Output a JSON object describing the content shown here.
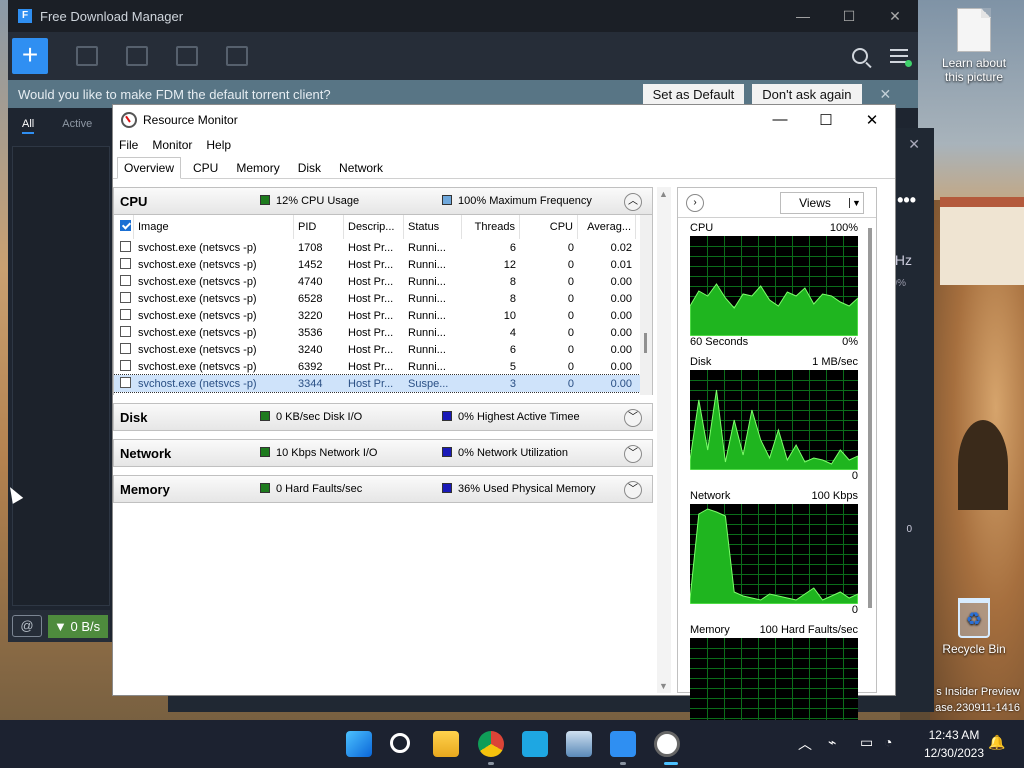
{
  "desktop": {
    "icons": [
      {
        "label": "Learn about this picture"
      },
      {
        "label": "Recycle Bin"
      }
    ],
    "watermark": {
      "line1": "s Insider Preview",
      "line2": "ase.230911-1416"
    }
  },
  "fdm": {
    "title": "Free Download Manager",
    "banner": {
      "text": "Would you like to make FDM the default torrent client?",
      "set_default": "Set as Default",
      "dont_ask": "Don't ask again"
    },
    "tabs": [
      "All",
      "Active"
    ],
    "speed": "0 B/s"
  },
  "bgwin": {
    "hz": "Hz",
    "pct": "0%",
    "zero": "0"
  },
  "rm": {
    "title": "Resource Monitor",
    "menu": [
      "File",
      "Monitor",
      "Help"
    ],
    "tabs": [
      "Overview",
      "CPU",
      "Memory",
      "Disk",
      "Network"
    ],
    "sections": {
      "cpu": {
        "name": "CPU",
        "stat1": "12% CPU Usage",
        "stat2": "100% Maximum Frequency",
        "c1": "#1e7b1e",
        "c2": "#6fa8dc"
      },
      "disk": {
        "name": "Disk",
        "stat1": "0 KB/sec Disk I/O",
        "stat2": "0% Highest Active Timee",
        "c1": "#1e7b1e",
        "c2": "#1a1ab8"
      },
      "network": {
        "name": "Network",
        "stat1": "10 Kbps Network I/O",
        "stat2": "0% Network Utilization",
        "c1": "#1e7b1e",
        "c2": "#1a1ab8"
      },
      "memory": {
        "name": "Memory",
        "stat1": "0 Hard Faults/sec",
        "stat2": "36% Used Physical Memory",
        "c1": "#1e7b1e",
        "c2": "#1a1ab8"
      }
    },
    "table": {
      "headers": {
        "image": "Image",
        "pid": "PID",
        "desc": "Descrip...",
        "status": "Status",
        "threads": "Threads",
        "cpu": "CPU",
        "avg": "Averag..."
      },
      "rows": [
        {
          "image": "svchost.exe (netsvcs -p)",
          "pid": "1708",
          "desc": "Host Pr...",
          "status": "Runni...",
          "threads": "6",
          "cpu": "0",
          "avg": "0.02"
        },
        {
          "image": "svchost.exe (netsvcs -p)",
          "pid": "1452",
          "desc": "Host Pr...",
          "status": "Runni...",
          "threads": "12",
          "cpu": "0",
          "avg": "0.01"
        },
        {
          "image": "svchost.exe (netsvcs -p)",
          "pid": "4740",
          "desc": "Host Pr...",
          "status": "Runni...",
          "threads": "8",
          "cpu": "0",
          "avg": "0.00"
        },
        {
          "image": "svchost.exe (netsvcs -p)",
          "pid": "6528",
          "desc": "Host Pr...",
          "status": "Runni...",
          "threads": "8",
          "cpu": "0",
          "avg": "0.00"
        },
        {
          "image": "svchost.exe (netsvcs -p)",
          "pid": "3220",
          "desc": "Host Pr...",
          "status": "Runni...",
          "threads": "10",
          "cpu": "0",
          "avg": "0.00"
        },
        {
          "image": "svchost.exe (netsvcs -p)",
          "pid": "3536",
          "desc": "Host Pr...",
          "status": "Runni...",
          "threads": "4",
          "cpu": "0",
          "avg": "0.00"
        },
        {
          "image": "svchost.exe (netsvcs -p)",
          "pid": "3240",
          "desc": "Host Pr...",
          "status": "Runni...",
          "threads": "6",
          "cpu": "0",
          "avg": "0.00"
        },
        {
          "image": "svchost.exe (netsvcs -p)",
          "pid": "6392",
          "desc": "Host Pr...",
          "status": "Runni...",
          "threads": "5",
          "cpu": "0",
          "avg": "0.00"
        },
        {
          "image": "svchost.exe (netsvcs -p)",
          "pid": "3344",
          "desc": "Host Pr...",
          "status": "Suspe...",
          "threads": "3",
          "cpu": "0",
          "avg": "0.00"
        }
      ]
    },
    "right": {
      "views": "Views",
      "graphs": [
        {
          "name": "CPU",
          "max": "100%",
          "foot_left": "60 Seconds",
          "foot_right": "0%"
        },
        {
          "name": "Disk",
          "max": "1 MB/sec",
          "foot_left": "",
          "foot_right": "0"
        },
        {
          "name": "Network",
          "max": "100 Kbps",
          "foot_left": "",
          "foot_right": "0"
        },
        {
          "name": "Memory",
          "max": "100 Hard Faults/sec",
          "foot_left": "",
          "foot_right": ""
        }
      ]
    }
  },
  "taskbar": {
    "apps": [
      "start-icon",
      "search-icon",
      "file-explorer-icon",
      "chrome-icon",
      "app-icon",
      "resource-graph-icon",
      "fdm-icon",
      "resource-monitor-icon"
    ],
    "time": "12:43 AM",
    "date": "12/30/2023"
  }
}
